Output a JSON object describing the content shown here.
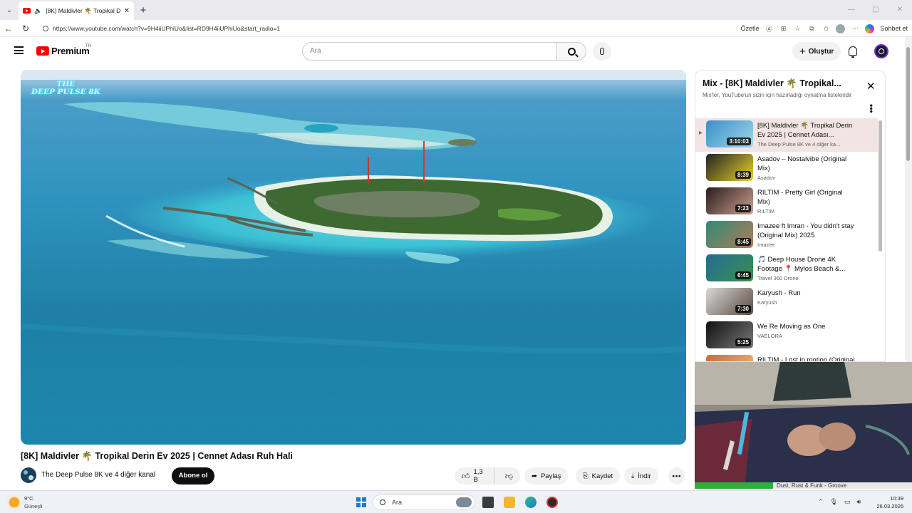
{
  "browser": {
    "tab_title": "[8K] Maldivler 🌴 Tropikal De",
    "url": "https://www.youtube.com/watch?v=9H4iiUPhiUo&list=RD9H4iiUPhiUo&start_radio=1",
    "summarize_label": "Özetle",
    "copilot_label": "Sohbet et"
  },
  "header": {
    "logo_text": "Premium",
    "country_code": "TR",
    "search_placeholder": "Ara",
    "create_label": "Oluştur"
  },
  "video": {
    "title": "[8K] Maldivler 🌴 Tropikal Derin Ev 2025 | Cennet Adası Ruh Hali",
    "watermark_line1": "THE",
    "watermark_line2": "DEEP PULSE 8K",
    "channel": "The Deep Pulse 8K ve 4 diğer kanal",
    "subscribe": "Abone ol",
    "likes": "1,3 B",
    "share": "Paylaş",
    "save": "Kaydet",
    "download": "İndir",
    "more": "•••"
  },
  "playlist": {
    "title": "Mix - [8K] Maldivler 🌴 Tropikal...",
    "subtitle": "Mix'ler, YouTube'un sizin için hazırladığı oynatma listeleridir",
    "close": "✕",
    "items": [
      {
        "title": "[8K] Maldivler 🌴 Tropikal Derin Ev 2025 | Cennet Adası...",
        "channel": "The Deep Pulse 8K ve 4 diğer ka...",
        "duration": "3:10:03",
        "index": "▶",
        "thumb_color": "#3a8fc9",
        "thumb_color2": "#9fd7e8"
      },
      {
        "title": "Asadov – Nostalvibe (Original Mix)",
        "channel": "Asadov",
        "duration": "8:39",
        "index": "",
        "thumb_color": "#222",
        "thumb_color2": "#e6d12a"
      },
      {
        "title": "RILTIM - Pretty Girl (Original Mix)",
        "channel": "RILTIM",
        "duration": "7:23",
        "index": "",
        "thumb_color": "#2b1b1f",
        "thumb_color2": "#c9a18c"
      },
      {
        "title": "Imazee ft Imran - You didn't stay (Original Mix) 2025",
        "channel": "Imazee",
        "duration": "8:45",
        "index": "",
        "thumb_color": "#2f8c7a",
        "thumb_color2": "#b07a55"
      },
      {
        "title": "🎵 Deep House Drone 4K Footage 📍 Mylos Beach &...",
        "channel": "Travel 360 Drone",
        "duration": "6:45",
        "index": "",
        "thumb_color": "#1f6f95",
        "thumb_color2": "#3c8f4a"
      },
      {
        "title": "Karyush - Run",
        "channel": "Karyush",
        "duration": "7:30",
        "index": "",
        "thumb_color": "#d9d9d9",
        "thumb_color2": "#5a4a40"
      },
      {
        "title": "We Re Moving as One",
        "channel": "VAELORA",
        "duration": "5:25",
        "index": "",
        "thumb_color": "#111",
        "thumb_color2": "#777"
      },
      {
        "title": "RILTIM - Lost in motion (Original Mix)",
        "channel": "",
        "duration": "",
        "index": "",
        "thumb_color": "#c96a3a",
        "thumb_color2": "#f0c080"
      }
    ]
  },
  "now_playing": {
    "text": "Dust, Rust & Funk - Groove"
  },
  "taskbar": {
    "temp": "9°C",
    "weather": "Güneşli",
    "search": "Ara",
    "time": "10:39",
    "date": "26.03.2026"
  }
}
